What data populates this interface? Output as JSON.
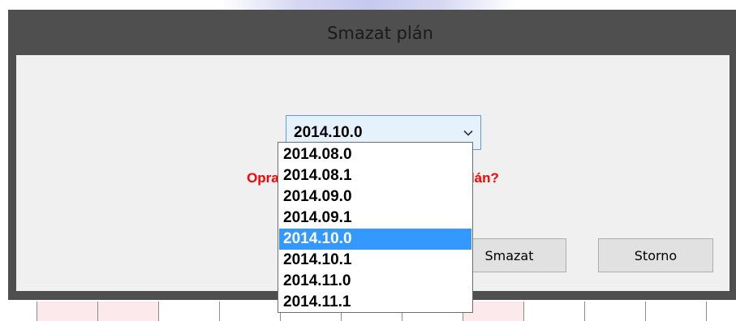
{
  "dialog": {
    "title": "Smazat plán",
    "question": "Opravdu chcete smazat vybraný plán?",
    "delete_button": "Smazat",
    "cancel_button": "Storno"
  },
  "plan_select": {
    "value": "2014.10.0",
    "options": [
      {
        "label": "2014.08.0",
        "selected": false
      },
      {
        "label": "2014.08.1",
        "selected": false
      },
      {
        "label": "2014.09.0",
        "selected": false
      },
      {
        "label": "2014.09.1",
        "selected": false
      },
      {
        "label": "2014.10.0",
        "selected": true
      },
      {
        "label": "2014.10.1",
        "selected": false
      },
      {
        "label": "2014.11.0",
        "selected": false
      },
      {
        "label": "2014.11.1",
        "selected": false
      }
    ]
  },
  "colors": {
    "question_text": "#ff0000",
    "selected_option_bg": "#3399ff",
    "dialog_frame": "#4f4f4f",
    "client_bg": "#f0f0f0"
  }
}
